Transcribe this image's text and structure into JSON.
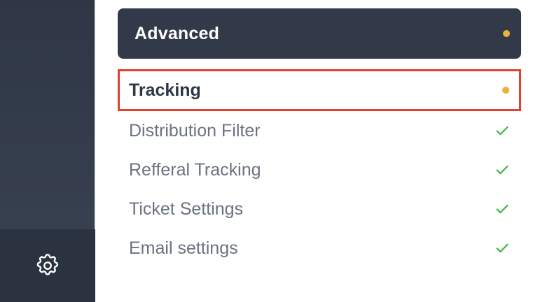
{
  "sidebar": {
    "settings_icon": "gear-icon"
  },
  "section": {
    "title": "Advanced",
    "status_color": "#e7b23e"
  },
  "items": [
    {
      "label": "Tracking",
      "status": "pending",
      "active": true
    },
    {
      "label": "Distribution Filter",
      "status": "done"
    },
    {
      "label": "Refferal Tracking",
      "status": "done"
    },
    {
      "label": "Ticket Settings",
      "status": "done"
    },
    {
      "label": "Email settings",
      "status": "done"
    }
  ],
  "colors": {
    "pending": "#e7b23e",
    "done": "#4cb84b",
    "highlight": "#e3412f"
  }
}
